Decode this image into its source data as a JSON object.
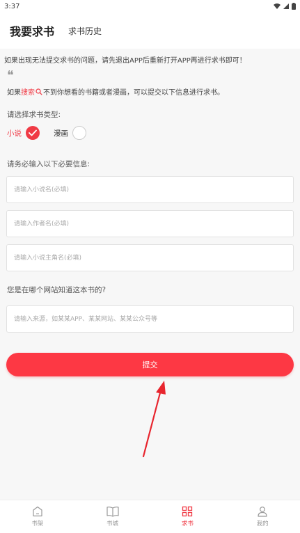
{
  "status_bar": {
    "time": "3:37"
  },
  "tabs": [
    {
      "label": "我要求书"
    },
    {
      "label": "求书历史"
    }
  ],
  "notice": "如果出现无法提交求书的问题，请先退出APP后重新打开APP再进行求书即可！",
  "intro": {
    "prefix": "如果",
    "highlight": "搜索",
    "suffix": "不到你想看的书籍或者漫画，可以提交以下信息进行求书。"
  },
  "type_section": {
    "label": "请选择求书类型:",
    "options": [
      {
        "label": "小说",
        "selected": true
      },
      {
        "label": "漫画",
        "selected": false
      }
    ]
  },
  "required_section": {
    "label": "请务必输入以下必要信息:"
  },
  "fields": {
    "novel_name": {
      "placeholder": "请输入小说名(必填)",
      "value": ""
    },
    "author_name": {
      "placeholder": "请输入作者名(必填)",
      "value": ""
    },
    "protagonist_name": {
      "placeholder": "请输入小说主角名(必填)",
      "value": ""
    }
  },
  "source_section": {
    "label": "您是在哪个网站知道这本书的?",
    "placeholder": "请输入来源，如某某APP、某某网站、某某公众号等",
    "value": ""
  },
  "submit_label": "提交",
  "bottom_nav": [
    {
      "label": "书架",
      "icon": "bookshelf-icon",
      "active": false
    },
    {
      "label": "书城",
      "icon": "book-store-icon",
      "active": false
    },
    {
      "label": "求书",
      "icon": "request-book-icon",
      "active": true
    },
    {
      "label": "我的",
      "icon": "profile-icon",
      "active": false
    }
  ],
  "colors": {
    "accent": "#f03a45",
    "button": "#fd3844",
    "background": "#f7f7f7"
  }
}
